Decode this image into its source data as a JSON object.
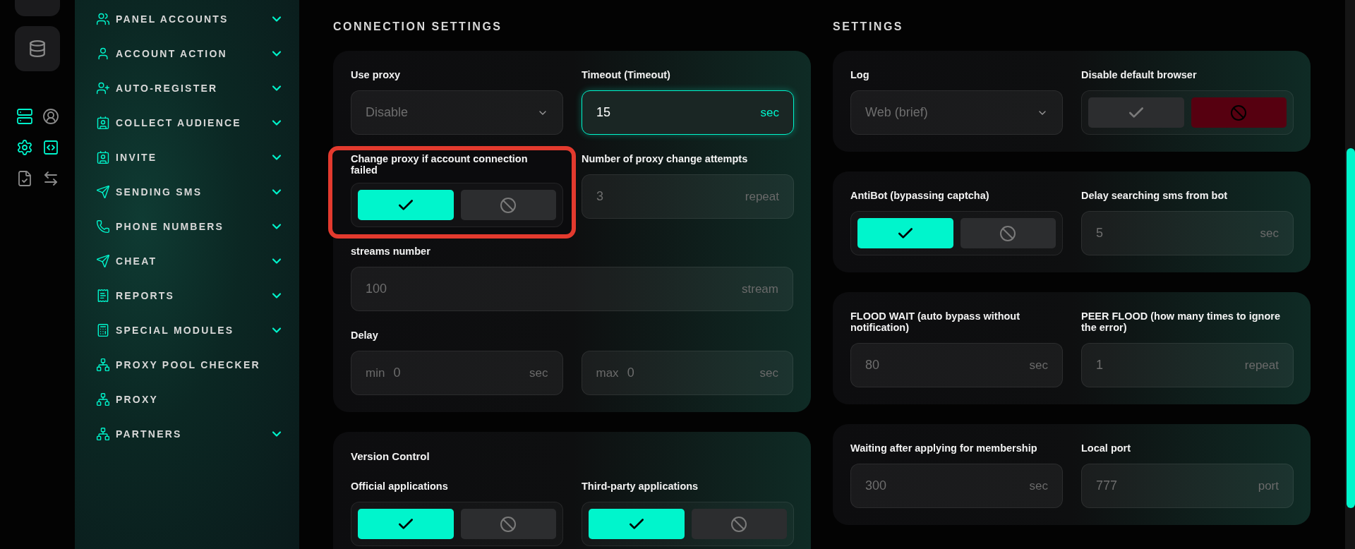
{
  "rail": {
    "icons": [
      {
        "active": true
      },
      {
        "active": false
      },
      {
        "active": true
      },
      {
        "active": true
      },
      {
        "active": false
      },
      {
        "active": false
      }
    ]
  },
  "sidebar": {
    "items": [
      {
        "label": "PANEL ACCOUNTS",
        "expandable": true
      },
      {
        "label": "ACCOUNT ACTION",
        "expandable": true
      },
      {
        "label": "AUTO-REGISTER",
        "expandable": true
      },
      {
        "label": "COLLECT AUDIENCE",
        "expandable": true
      },
      {
        "label": "INVITE",
        "expandable": true
      },
      {
        "label": "SENDING SMS",
        "expandable": true
      },
      {
        "label": "PHONE NUMBERS",
        "expandable": true
      },
      {
        "label": "CHEAT",
        "expandable": true
      },
      {
        "label": "REPORTS",
        "expandable": true
      },
      {
        "label": "SPECIAL MODULES",
        "expandable": true
      },
      {
        "label": "PROXY POOL CHECKER",
        "expandable": false
      },
      {
        "label": "PROXY",
        "expandable": false
      },
      {
        "label": "PARTNERS",
        "expandable": true
      }
    ]
  },
  "columns": [
    {
      "title": "CONNECTION SETTINGS",
      "cards": [
        {
          "rows": [
            [
              {
                "kind": "select",
                "label": "Use proxy",
                "value": "Disable"
              },
              {
                "kind": "input",
                "label": "Timeout (Timeout)",
                "value": "15",
                "unit": "sec",
                "focused": true
              }
            ],
            [
              {
                "kind": "toggle",
                "label": "Change proxy if account connection failed",
                "enabled": true,
                "highlighted": true
              },
              {
                "kind": "input",
                "label": "Number of proxy change attempts",
                "value": "3",
                "unit": "repeat",
                "focused": false
              }
            ],
            [
              {
                "kind": "input",
                "label": "streams number",
                "value": "100",
                "unit": "stream",
                "focused": false
              }
            ],
            [
              {
                "kind": "range",
                "label": "Delay",
                "inputs": [
                  {
                    "prefix": "min",
                    "value": "0",
                    "unit": "sec"
                  },
                  {
                    "prefix": "max",
                    "value": "0",
                    "unit": "sec"
                  }
                ]
              }
            ]
          ]
        },
        {
          "heading": "Version Control",
          "rows": [
            [
              {
                "kind": "toggle",
                "label": "Official applications",
                "enabled": true,
                "highlighted": false
              },
              {
                "kind": "toggle",
                "label": "Third-party applications",
                "enabled": true,
                "highlighted": false
              }
            ]
          ]
        }
      ]
    },
    {
      "title": "SETTINGS",
      "cards": [
        {
          "rows": [
            [
              {
                "kind": "select",
                "label": "Log",
                "value": "Web (brief)"
              },
              {
                "kind": "toggle",
                "label": "Disable default browser",
                "enabled": false,
                "highlighted": false
              }
            ]
          ]
        },
        {
          "rows": [
            [
              {
                "kind": "toggle",
                "label": "AntiBot (bypassing captcha)",
                "enabled": true,
                "highlighted": false
              },
              {
                "kind": "input",
                "label": "Delay searching sms from bot",
                "value": "5",
                "unit": "sec",
                "focused": false
              }
            ]
          ]
        },
        {
          "rows": [
            [
              {
                "kind": "input",
                "label": "FLOOD WAIT (auto bypass without notification)",
                "value": "80",
                "unit": "sec",
                "focused": false
              },
              {
                "kind": "input",
                "label": "PEER FLOOD (how many times to ignore the error)",
                "value": "1",
                "unit": "repeat",
                "focused": false
              }
            ]
          ]
        },
        {
          "rows": [
            [
              {
                "kind": "input",
                "label": "Waiting after applying for membership",
                "value": "300",
                "unit": "sec",
                "focused": false
              },
              {
                "kind": "input",
                "label": "Local port",
                "value": "777",
                "unit": "port",
                "focused": false
              }
            ]
          ]
        }
      ]
    }
  ]
}
